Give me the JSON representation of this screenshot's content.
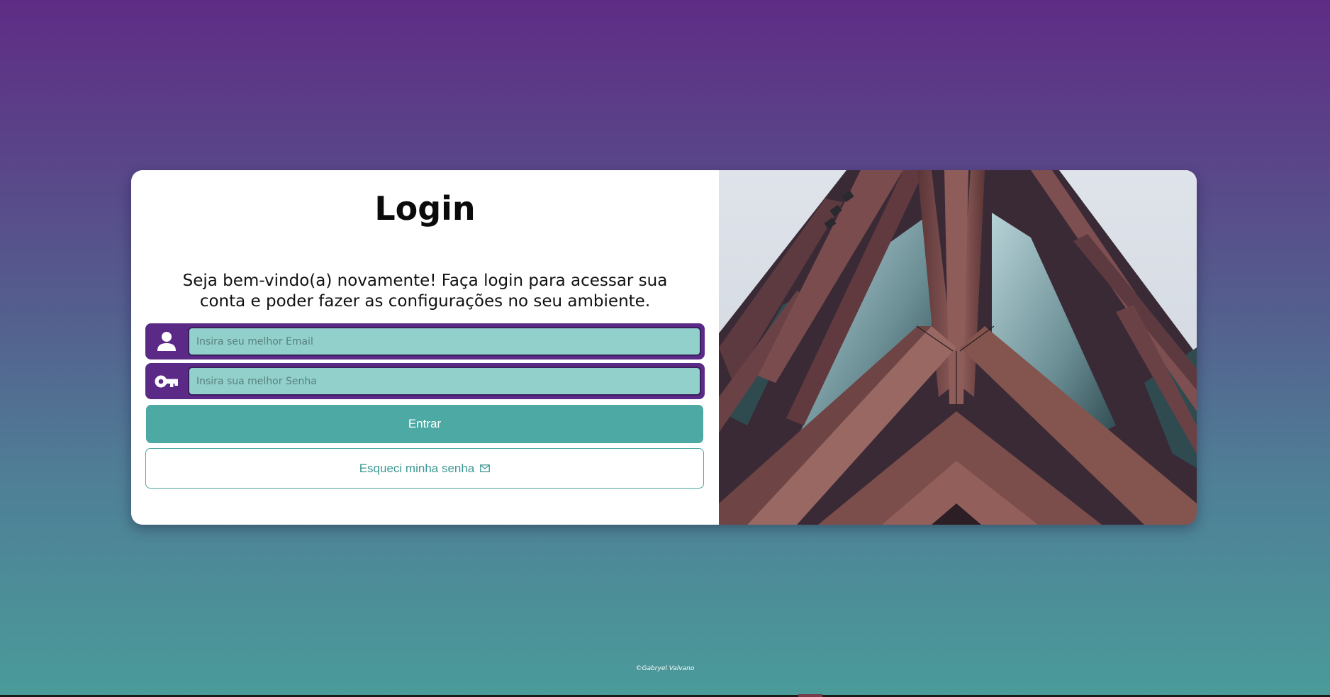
{
  "login": {
    "title": "Login",
    "subtitle": "Seja bem-vindo(a) novamente! Faça login para acessar sua conta e poder fazer as configurações no seu ambiente.",
    "email": {
      "placeholder": "Insira seu melhor Email",
      "value": "",
      "icon": "user-icon"
    },
    "password": {
      "placeholder": "Insira sua melhor Senha",
      "value": "",
      "icon": "key-icon"
    },
    "submit_label": "Entrar",
    "forgot_label": "Esqueci minha senha",
    "forgot_icon": "envelope-icon"
  },
  "hero_image": {
    "subject": "building-facade-photo"
  },
  "footer": {
    "credit": "©Gabryel Valvano"
  },
  "colors": {
    "background_top": "#5f2c85",
    "background_bottom": "#4a9b9a",
    "field_frame": "#5b2a86",
    "input_fill": "#92d0cc",
    "primary_button": "#4da9a3",
    "forgot_text": "#3f9993"
  }
}
